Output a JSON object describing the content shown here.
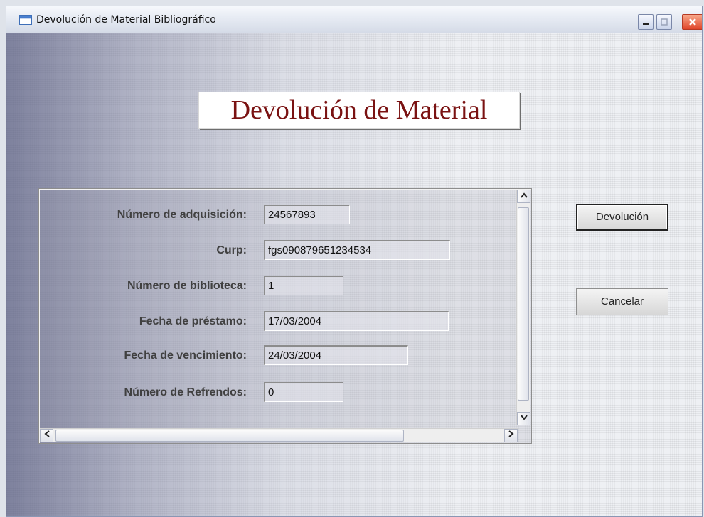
{
  "window": {
    "title": "Devolución de Material Bibliográfico",
    "controls": [
      "minimize-icon",
      "maximize-icon",
      "close-icon"
    ]
  },
  "heading": "Devolución de Material",
  "form": {
    "fields": [
      {
        "label": "Número de adquisición:",
        "value": "24567893"
      },
      {
        "label": "Curp:",
        "value": "fgs090879651234534"
      },
      {
        "label": "Número de biblioteca:",
        "value": "1"
      },
      {
        "label": "Fecha de préstamo:",
        "value": "17/03/2004"
      },
      {
        "label": "Fecha de vencimiento:",
        "value": "24/03/2004"
      },
      {
        "label": "Número de Refrendos:",
        "value": "0"
      }
    ]
  },
  "buttons": {
    "devolucion": "Devolución",
    "cancelar": "Cancelar"
  },
  "colors": {
    "heading_text": "#7a1212",
    "close_button": "#e0462a"
  }
}
